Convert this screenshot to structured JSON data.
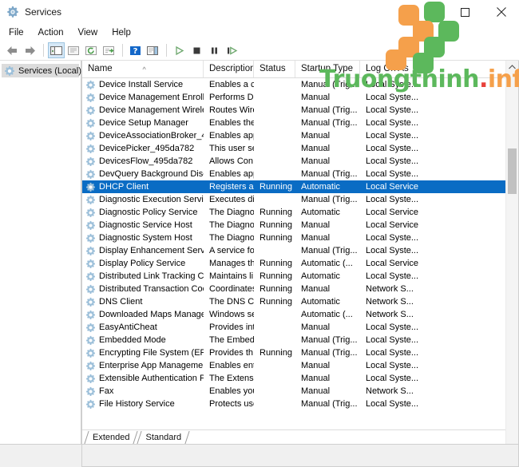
{
  "window": {
    "title": "Services",
    "icon": "services-gear-icon",
    "controls": {
      "minimize": "minimize-icon",
      "maximize": "maximize-icon",
      "close": "close-icon"
    }
  },
  "menubar": {
    "items": [
      {
        "label": "File"
      },
      {
        "label": "Action"
      },
      {
        "label": "View"
      },
      {
        "label": "Help"
      }
    ]
  },
  "toolbar": {
    "buttons": [
      {
        "name": "back-arrow-icon",
        "pressed": false
      },
      {
        "name": "forward-arrow-icon",
        "pressed": false
      },
      {
        "name": "show-hide-console-tree-icon",
        "pressed": true
      },
      {
        "name": "export-list-icon",
        "pressed": false
      },
      {
        "name": "refresh-icon",
        "pressed": false
      },
      {
        "name": "properties-icon",
        "pressed": false
      },
      {
        "name": "help-icon",
        "pressed": false
      },
      {
        "name": "show-hide-action-pane-icon",
        "pressed": false
      },
      {
        "name": "start-service-icon",
        "pressed": false
      },
      {
        "name": "stop-service-icon",
        "pressed": false
      },
      {
        "name": "pause-service-icon",
        "pressed": false
      },
      {
        "name": "restart-service-icon",
        "pressed": false
      }
    ]
  },
  "tree": {
    "nodes": [
      {
        "label": "Services (Local)",
        "icon": "services-gear-icon",
        "selected": true
      }
    ]
  },
  "list": {
    "columns": [
      {
        "label": "Name",
        "sorted": "asc"
      },
      {
        "label": "Description",
        "sorted": ""
      },
      {
        "label": "Status",
        "sorted": ""
      },
      {
        "label": "Startup Type",
        "sorted": ""
      },
      {
        "label": "Log On As",
        "sorted": ""
      }
    ],
    "rows": [
      {
        "name": "Device Install Service",
        "desc": "Enables a c...",
        "status": "",
        "start": "Manual (Trig...",
        "logon": "Local Syste...",
        "selected": false
      },
      {
        "name": "Device Management Enroll...",
        "desc": "Performs D...",
        "status": "",
        "start": "Manual",
        "logon": "Local Syste...",
        "selected": false
      },
      {
        "name": "Device Management Wirele...",
        "desc": "Routes Wire...",
        "status": "",
        "start": "Manual (Trig...",
        "logon": "Local Syste...",
        "selected": false
      },
      {
        "name": "Device Setup Manager",
        "desc": "Enables the ...",
        "status": "",
        "start": "Manual (Trig...",
        "logon": "Local Syste...",
        "selected": false
      },
      {
        "name": "DeviceAssociationBroker_49...",
        "desc": "Enables app...",
        "status": "",
        "start": "Manual",
        "logon": "Local Syste...",
        "selected": false
      },
      {
        "name": "DevicePicker_495da782",
        "desc": "This user ser...",
        "status": "",
        "start": "Manual",
        "logon": "Local Syste...",
        "selected": false
      },
      {
        "name": "DevicesFlow_495da782",
        "desc": "Allows Con...",
        "status": "",
        "start": "Manual",
        "logon": "Local Syste...",
        "selected": false
      },
      {
        "name": "DevQuery Background Disc...",
        "desc": "Enables app...",
        "status": "",
        "start": "Manual (Trig...",
        "logon": "Local Syste...",
        "selected": false
      },
      {
        "name": "DHCP Client",
        "desc": "Registers an...",
        "status": "Running",
        "start": "Automatic",
        "logon": "Local Service",
        "selected": true
      },
      {
        "name": "Diagnostic Execution Service",
        "desc": "Executes di...",
        "status": "",
        "start": "Manual (Trig...",
        "logon": "Local Syste...",
        "selected": false
      },
      {
        "name": "Diagnostic Policy Service",
        "desc": "The Diagno...",
        "status": "Running",
        "start": "Automatic",
        "logon": "Local Service",
        "selected": false
      },
      {
        "name": "Diagnostic Service Host",
        "desc": "The Diagno...",
        "status": "Running",
        "start": "Manual",
        "logon": "Local Service",
        "selected": false
      },
      {
        "name": "Diagnostic System Host",
        "desc": "The Diagno...",
        "status": "Running",
        "start": "Manual",
        "logon": "Local Syste...",
        "selected": false
      },
      {
        "name": "Display Enhancement Service",
        "desc": "A service fo...",
        "status": "",
        "start": "Manual (Trig...",
        "logon": "Local Syste...",
        "selected": false
      },
      {
        "name": "Display Policy Service",
        "desc": "Manages th...",
        "status": "Running",
        "start": "Automatic (...",
        "logon": "Local Service",
        "selected": false
      },
      {
        "name": "Distributed Link Tracking Cli...",
        "desc": "Maintains li...",
        "status": "Running",
        "start": "Automatic",
        "logon": "Local Syste...",
        "selected": false
      },
      {
        "name": "Distributed Transaction Coo...",
        "desc": "Coordinates...",
        "status": "Running",
        "start": "Manual",
        "logon": "Network S...",
        "selected": false
      },
      {
        "name": "DNS Client",
        "desc": "The DNS Cli...",
        "status": "Running",
        "start": "Automatic",
        "logon": "Network S...",
        "selected": false
      },
      {
        "name": "Downloaded Maps Manager",
        "desc": "Windows se...",
        "status": "",
        "start": "Automatic (...",
        "logon": "Network S...",
        "selected": false
      },
      {
        "name": "EasyAntiCheat",
        "desc": "Provides int...",
        "status": "",
        "start": "Manual",
        "logon": "Local Syste...",
        "selected": false
      },
      {
        "name": "Embedded Mode",
        "desc": "The Embed...",
        "status": "",
        "start": "Manual (Trig...",
        "logon": "Local Syste...",
        "selected": false
      },
      {
        "name": "Encrypting File System (EFS)",
        "desc": "Provides th...",
        "status": "Running",
        "start": "Manual (Trig...",
        "logon": "Local Syste...",
        "selected": false
      },
      {
        "name": "Enterprise App Managemen...",
        "desc": "Enables ent...",
        "status": "",
        "start": "Manual",
        "logon": "Local Syste...",
        "selected": false
      },
      {
        "name": "Extensible Authentication P...",
        "desc": "The Extensi...",
        "status": "",
        "start": "Manual",
        "logon": "Local Syste...",
        "selected": false
      },
      {
        "name": "Fax",
        "desc": "Enables you...",
        "status": "",
        "start": "Manual",
        "logon": "Network S...",
        "selected": false
      },
      {
        "name": "File History Service",
        "desc": "Protects use...",
        "status": "",
        "start": "Manual (Trig...",
        "logon": "Local Syste...",
        "selected": false
      }
    ],
    "scrollbar": {
      "up_arrow": "chevron-up-icon",
      "down_arrow": "chevron-down-icon"
    }
  },
  "tabs": [
    {
      "label": "Extended",
      "active": false
    },
    {
      "label": "Standard",
      "active": true
    }
  ],
  "watermark": {
    "text_main": "Truongthinh",
    "text_dot": ".",
    "text_suffix": "info",
    "color_green": "#5cb85c",
    "color_orange": "#f5a04b",
    "color_dot": "#e8403a"
  },
  "colors": {
    "selection_blue": "#0a6cc4",
    "window_bg": "#ffffff",
    "pane_bg": "#f0f0f0"
  }
}
